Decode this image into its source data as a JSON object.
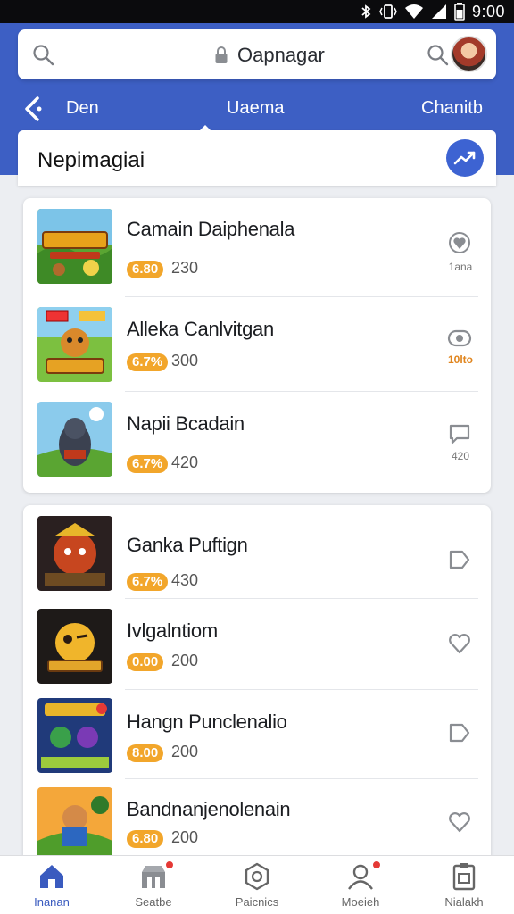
{
  "status_bar": {
    "time": "9:00",
    "icons": [
      "bluetooth-icon",
      "vibrate-icon",
      "wifi-icon",
      "signal-icon",
      "battery-icon"
    ]
  },
  "search": {
    "text": "Oapnagar"
  },
  "nav_tabs": {
    "left": "Den",
    "center": "Uaema",
    "right": "Chanitb"
  },
  "section": {
    "title": "Nepimagiai"
  },
  "games": [
    {
      "title": "Camain Daiphenala",
      "rating": "6.80",
      "count": "230",
      "action_icon": "heart-icon",
      "action_label": "1ana",
      "action_hot": false
    },
    {
      "title": "Alleka Canlvitgan",
      "rating": "6.7%",
      "count": "300",
      "action_icon": "chat-icon",
      "action_label": "10lto",
      "action_hot": true
    },
    {
      "title": "Napii Bcadain",
      "rating": "6.7%",
      "count": "420",
      "action_icon": "comment-icon",
      "action_label": "420",
      "action_hot": false
    },
    {
      "title": "Ganka Puftign",
      "rating": "6.7%",
      "count": "430",
      "action_icon": "tag-icon",
      "action_label": "",
      "action_hot": false
    },
    {
      "title": "Ivlgalntiom",
      "rating": "0.00",
      "count": "200",
      "action_icon": "heart-icon",
      "action_label": "",
      "action_hot": false
    },
    {
      "title": "Hangn Punclenalio",
      "rating": "8.00",
      "count": "200",
      "action_icon": "tag-icon",
      "action_label": "",
      "action_hot": false
    },
    {
      "title": "Bandnanjenolenain",
      "rating": "6.80",
      "count": "200",
      "action_icon": "heart-icon",
      "action_label": "",
      "action_hot": false
    }
  ],
  "bottom_nav": [
    {
      "label": "Inanan",
      "icon": "home-icon",
      "active": true,
      "badge": false
    },
    {
      "label": "Seatbe",
      "icon": "store-icon",
      "active": false,
      "badge": true
    },
    {
      "label": "Paicnics",
      "icon": "hexagon-icon",
      "active": false,
      "badge": false
    },
    {
      "label": "Moeieh",
      "icon": "profile-icon",
      "active": false,
      "badge": true
    },
    {
      "label": "Nialakh",
      "icon": "clipboard-icon",
      "active": false,
      "badge": false
    }
  ],
  "colors": {
    "header_blue": "#3d5fc4",
    "rating_orange": "#f2a62b",
    "badge_red": "#e53935",
    "active_nav": "#3a5bbf"
  }
}
